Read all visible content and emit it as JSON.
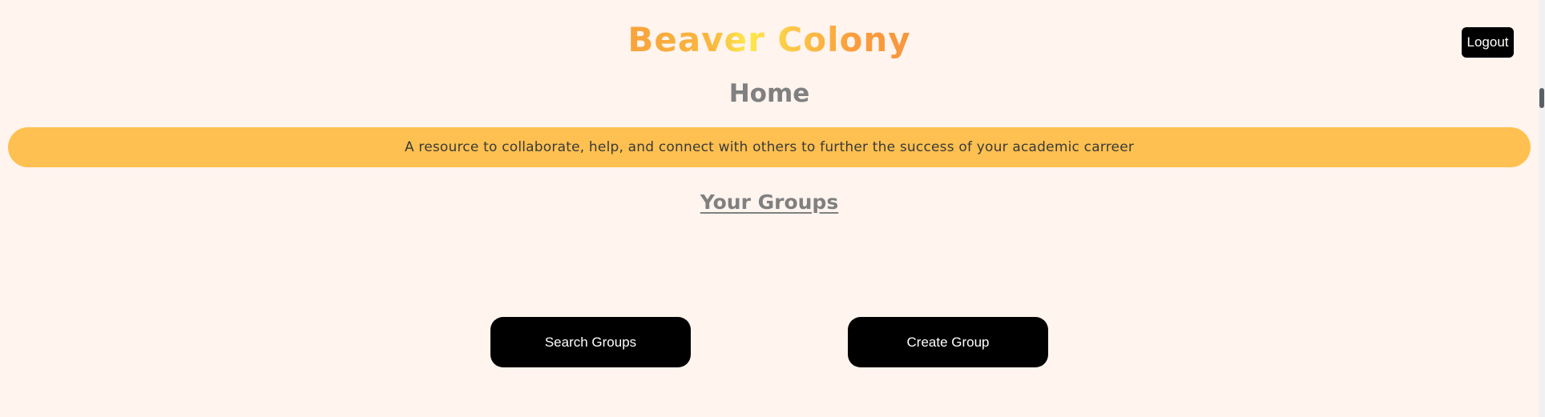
{
  "header": {
    "app_title": "Beaver Colony",
    "logout_label": "Logout"
  },
  "main": {
    "page_heading": "Home",
    "tagline": "A resource to collaborate, help, and connect with others to further the success of your academic carreer",
    "groups_heading": "Your Groups",
    "groups": [],
    "actions": {
      "search_label": "Search Groups",
      "create_label": "Create Group"
    }
  },
  "colors": {
    "background": "#fff4ee",
    "banner": "#fec050",
    "title_gradient": [
      "#f8a23c",
      "#fde84d",
      "#f8963c"
    ],
    "heading": "#808080",
    "button": "#000000"
  }
}
